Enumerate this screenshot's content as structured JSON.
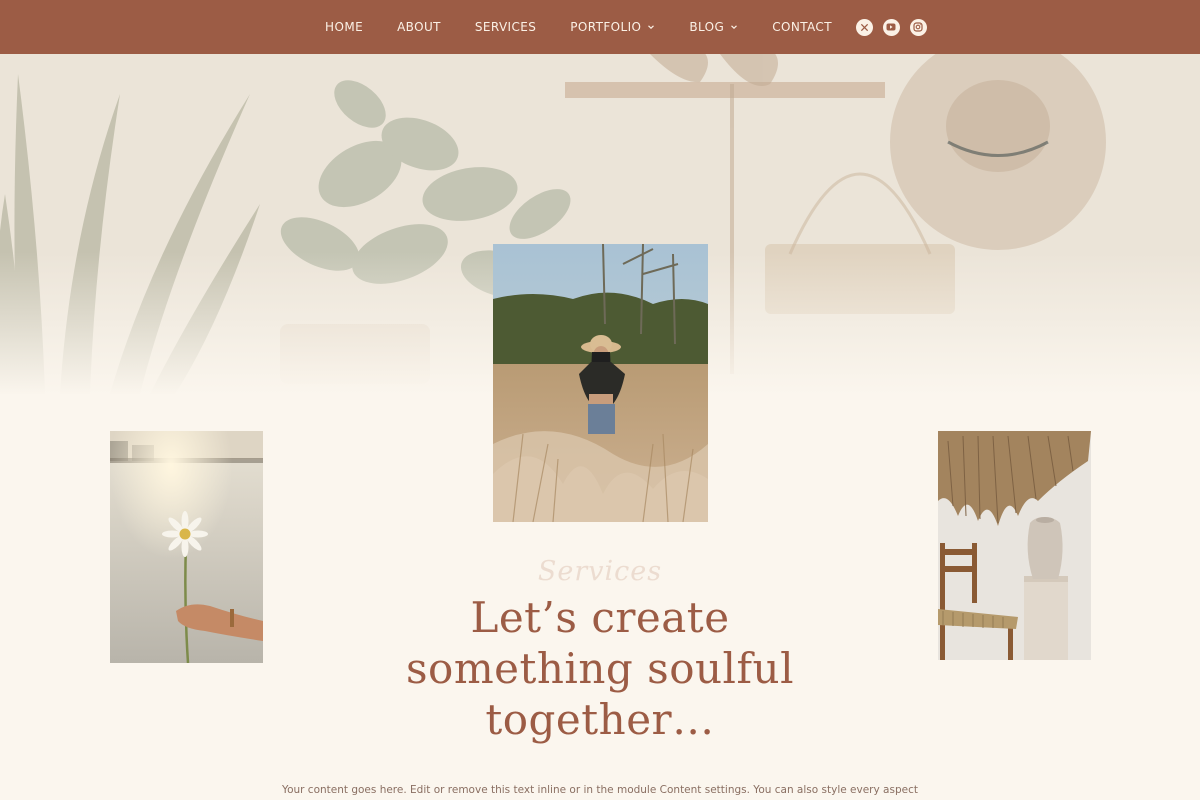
{
  "nav": {
    "items": [
      {
        "label": "HOME",
        "has_dropdown": false
      },
      {
        "label": "ABOUT",
        "has_dropdown": false
      },
      {
        "label": "SERVICES",
        "has_dropdown": false
      },
      {
        "label": "PORTFOLIO",
        "has_dropdown": true
      },
      {
        "label": "BLOG",
        "has_dropdown": true
      },
      {
        "label": "CONTACT",
        "has_dropdown": false
      }
    ],
    "social_icons": [
      "x-icon",
      "youtube-icon",
      "instagram-icon"
    ],
    "background_color": "#9c5c45"
  },
  "section": {
    "script_label": "Services",
    "heading": "Let’s create something soulful together…",
    "body": "Your content goes here. Edit or remove this text inline or in the module Content settings. You can also style every aspect"
  },
  "colors": {
    "accent": "#9c5c45",
    "background": "#fbf6ee"
  }
}
